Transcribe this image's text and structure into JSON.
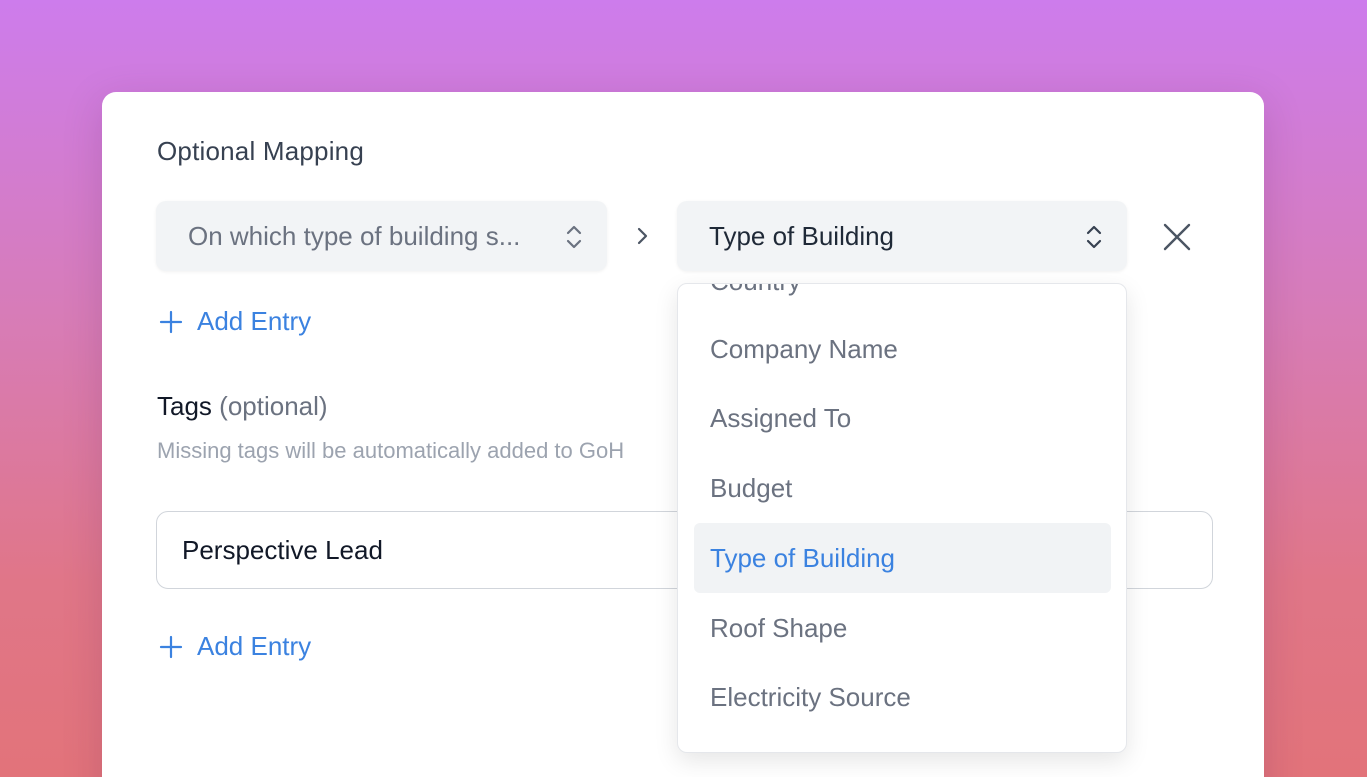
{
  "optional_mapping": {
    "title": "Optional Mapping",
    "source_select_value": "On which type of building s...",
    "target_select_value": "Type of Building",
    "add_entry_label": "Add Entry"
  },
  "tags": {
    "label": "Tags",
    "optional_suffix": "(optional)",
    "help_text": "Missing tags will be automatically added to GoH",
    "input_value": "Perspective Lead",
    "add_entry_label": "Add Entry"
  },
  "dropdown": {
    "items": [
      {
        "label": "Country"
      },
      {
        "label": "Company Name"
      },
      {
        "label": "Assigned To"
      },
      {
        "label": "Budget"
      },
      {
        "label": "Type of Building",
        "selected": true
      },
      {
        "label": "Roof Shape"
      },
      {
        "label": "Electricity Source"
      }
    ]
  },
  "icons": {
    "select_source": "up-down-chevron-icon",
    "select_target": "up-down-chevron-icon",
    "mapping_arrow": "chevron-right-icon",
    "remove": "close-icon",
    "add": "plus-icon"
  },
  "colors": {
    "accent": "#3b82e0",
    "selected_bg": "#f1f3f5"
  }
}
